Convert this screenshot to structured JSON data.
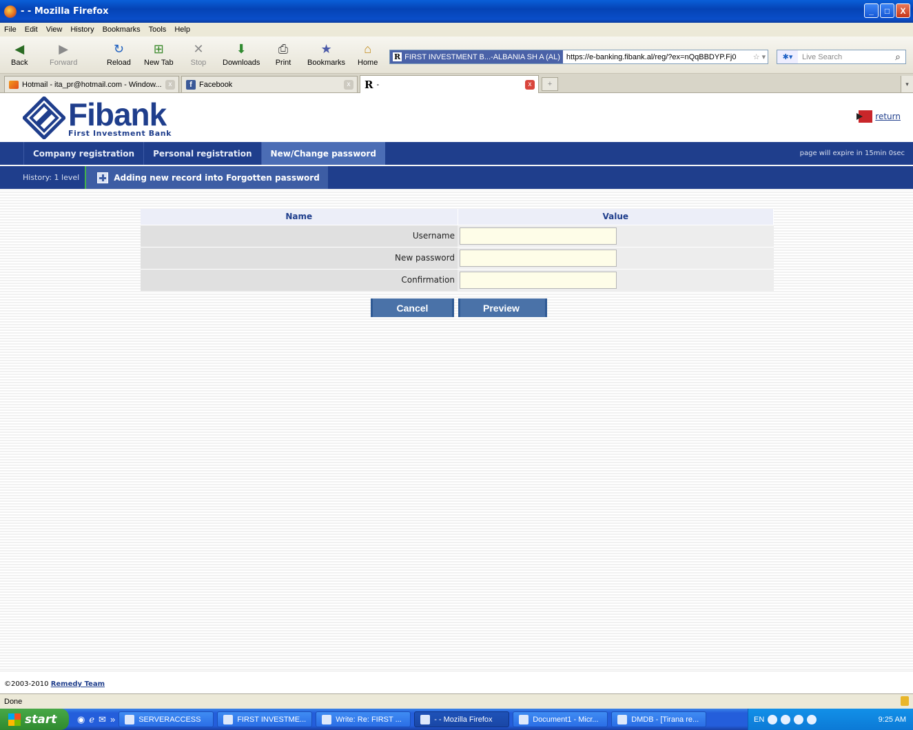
{
  "window": {
    "title": "- - Mozilla Firefox",
    "minimize": "_",
    "maximize": "□",
    "close": "X"
  },
  "menu": [
    "File",
    "Edit",
    "View",
    "History",
    "Bookmarks",
    "Tools",
    "Help"
  ],
  "nav": {
    "back": "Back",
    "forward": "Forward",
    "reload": "Reload",
    "newtab": "New Tab",
    "stop": "Stop",
    "downloads": "Downloads",
    "print": "Print",
    "bookmarks": "Bookmarks",
    "home": "Home"
  },
  "address": {
    "identity": "FIRST INVESTMENT B...-ALBANIA SH A (AL)",
    "url": "https://e-banking.fibank.al/reg/?ex=nQqBBDYP.Fj0"
  },
  "search": {
    "placeholder": "Live Search"
  },
  "tabs": [
    {
      "label": "Hotmail - ita_pr@hotmail.com - Window..."
    },
    {
      "label": "Facebook"
    },
    {
      "label": "-"
    }
  ],
  "site": {
    "logo_big": "Fibank",
    "logo_small": "First Investment Bank",
    "return_label": "return",
    "mainnav": [
      "Company registration",
      "Personal registration",
      "New/Change password"
    ],
    "expire_text": "page will expire in 15min 0sec",
    "history_level": "History: 1 level",
    "history_record": "Adding new record into Forgotten password"
  },
  "form": {
    "header_name": "Name",
    "header_value": "Value",
    "rows": [
      {
        "label": "Username",
        "value": ""
      },
      {
        "label": "New password",
        "value": ""
      },
      {
        "label": "Confirmation",
        "value": ""
      }
    ],
    "cancel": "Cancel",
    "preview": "Preview"
  },
  "footer": {
    "copyright": "©2003-2010",
    "link": "Remedy Team"
  },
  "status": "Done",
  "taskbar": {
    "start": "start",
    "tasks": [
      "SERVERACCESS",
      "FIRST INVESTME...",
      "Write: Re: FIRST ...",
      "- - Mozilla Firefox",
      "Document1 - Micr...",
      "DMDB - [Tirana re..."
    ],
    "lang": "EN",
    "clock": "9:25 AM"
  },
  "colors": {
    "brand": "#1f3e8c",
    "nav_active": "#4b6db5",
    "button": "#4a72a8",
    "input_bg": "#fefde8"
  }
}
